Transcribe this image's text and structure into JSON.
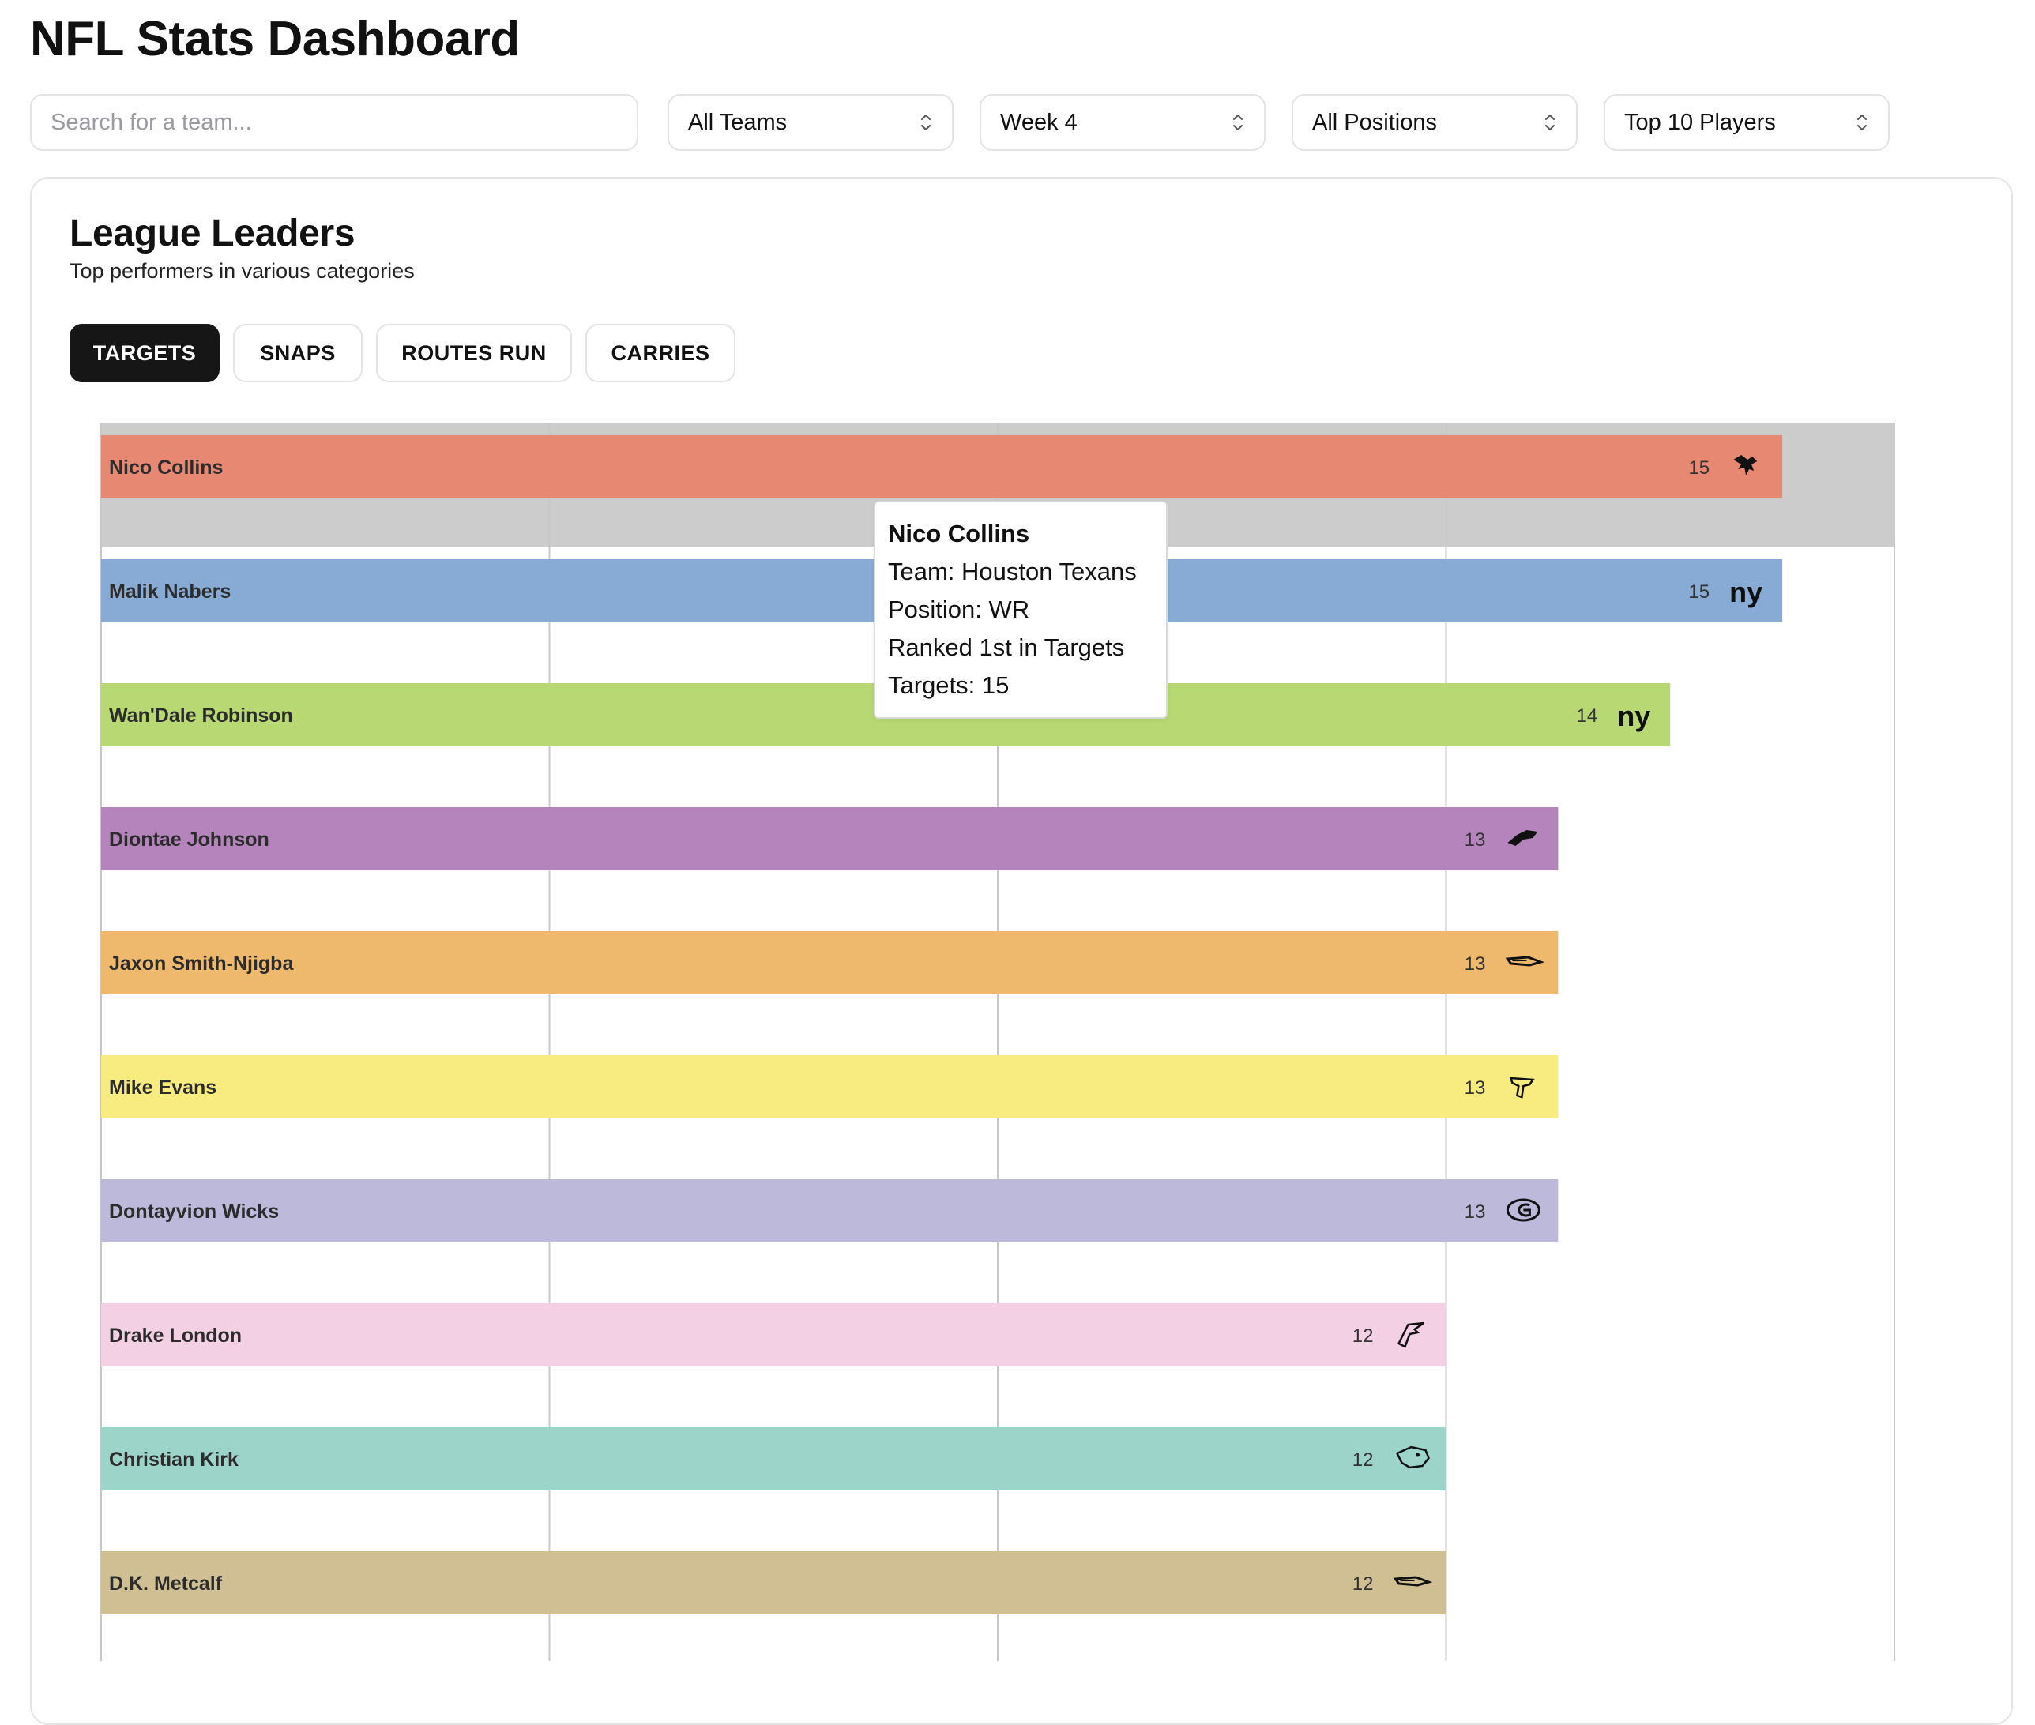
{
  "header": {
    "title": "NFL Stats Dashboard"
  },
  "filters": {
    "search_placeholder": "Search for a team...",
    "team_select": "All Teams",
    "week_select": "Week 4",
    "position_select": "All Positions",
    "limit_select": "Top 10 Players"
  },
  "card": {
    "title": "League Leaders",
    "subtitle": "Top performers in various categories",
    "tabs": [
      {
        "label": "TARGETS",
        "active": true
      },
      {
        "label": "SNAPS",
        "active": false
      },
      {
        "label": "ROUTES RUN",
        "active": false
      },
      {
        "label": "CARRIES",
        "active": false
      }
    ]
  },
  "chart_data": {
    "type": "bar",
    "orientation": "horizontal",
    "metric": "Targets",
    "xlim": [
      0,
      16
    ],
    "grid": true,
    "highlighted_index": 0,
    "categories": [
      "Nico Collins",
      "Malik Nabers",
      "Wan'Dale Robinson",
      "Diontae Johnson",
      "Jaxon Smith-Njigba",
      "Mike Evans",
      "Dontayvion Wicks",
      "Drake London",
      "Christian Kirk",
      "D.K. Metcalf"
    ],
    "values": [
      15,
      15,
      14,
      13,
      13,
      13,
      13,
      12,
      12,
      12
    ],
    "colors": [
      "#e78873",
      "#87abd4",
      "#b8d873",
      "#b584bd",
      "#eeb96c",
      "#f8ec80",
      "#bcb9da",
      "#f3d0e4",
      "#9dd4c9",
      "#d1bf94"
    ],
    "team_icons": [
      "texans-icon",
      "giants-icon",
      "giants-icon",
      "panthers-icon",
      "seahawks-icon",
      "buccaneers-icon",
      "packers-icon",
      "falcons-icon",
      "jaguars-icon",
      "seahawks-icon"
    ]
  },
  "tooltip": {
    "name": "Nico Collins",
    "team": "Team: Houston Texans",
    "position": "Position: WR",
    "rank": "Ranked 1st in Targets",
    "value": "Targets: 15"
  }
}
